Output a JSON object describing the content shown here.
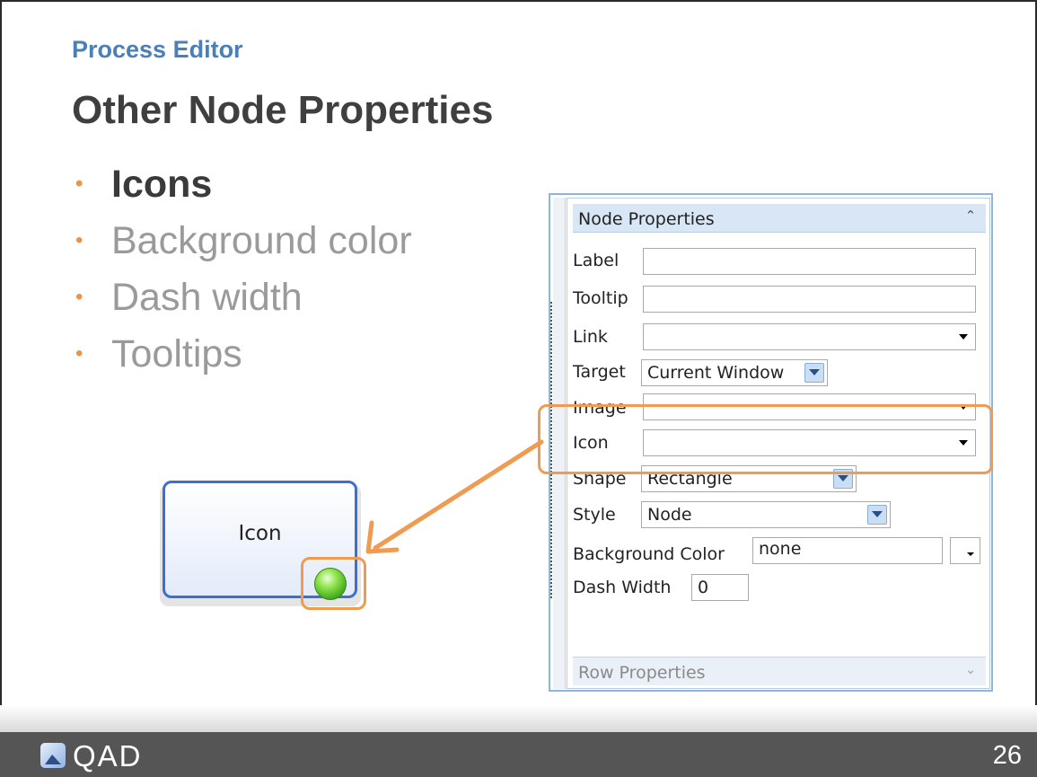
{
  "slide": {
    "section": "Process Editor",
    "title": "Other Node Properties",
    "bullets": [
      "Icons",
      "Background color",
      "Dash width",
      "Tooltips"
    ],
    "page_number": "26",
    "logo_text": "QAD"
  },
  "node_sample": {
    "label": "Icon",
    "icon": "green-circle-icon"
  },
  "panel": {
    "header": "Node Properties",
    "fields": {
      "label": {
        "label": "Label",
        "value": ""
      },
      "tooltip": {
        "label": "Tooltip",
        "value": ""
      },
      "link": {
        "label": "Link",
        "value": ""
      },
      "target": {
        "label": "Target",
        "value": "Current Window"
      },
      "image": {
        "label": "Image",
        "value": ""
      },
      "icon": {
        "label": "Icon",
        "value": ""
      },
      "shape": {
        "label": "Shape",
        "value": "Rectangle"
      },
      "style": {
        "label": "Style",
        "value": "Node"
      },
      "background_color": {
        "label": "Background Color",
        "value": "none"
      },
      "dash_width": {
        "label": "Dash Width",
        "value": "0"
      }
    },
    "collapsed_section": "Row Properties"
  },
  "colors": {
    "accent_orange": "#ef9b52",
    "section_blue": "#4a7fb8",
    "node_border": "#3b6fd0",
    "footer": "#555555"
  }
}
